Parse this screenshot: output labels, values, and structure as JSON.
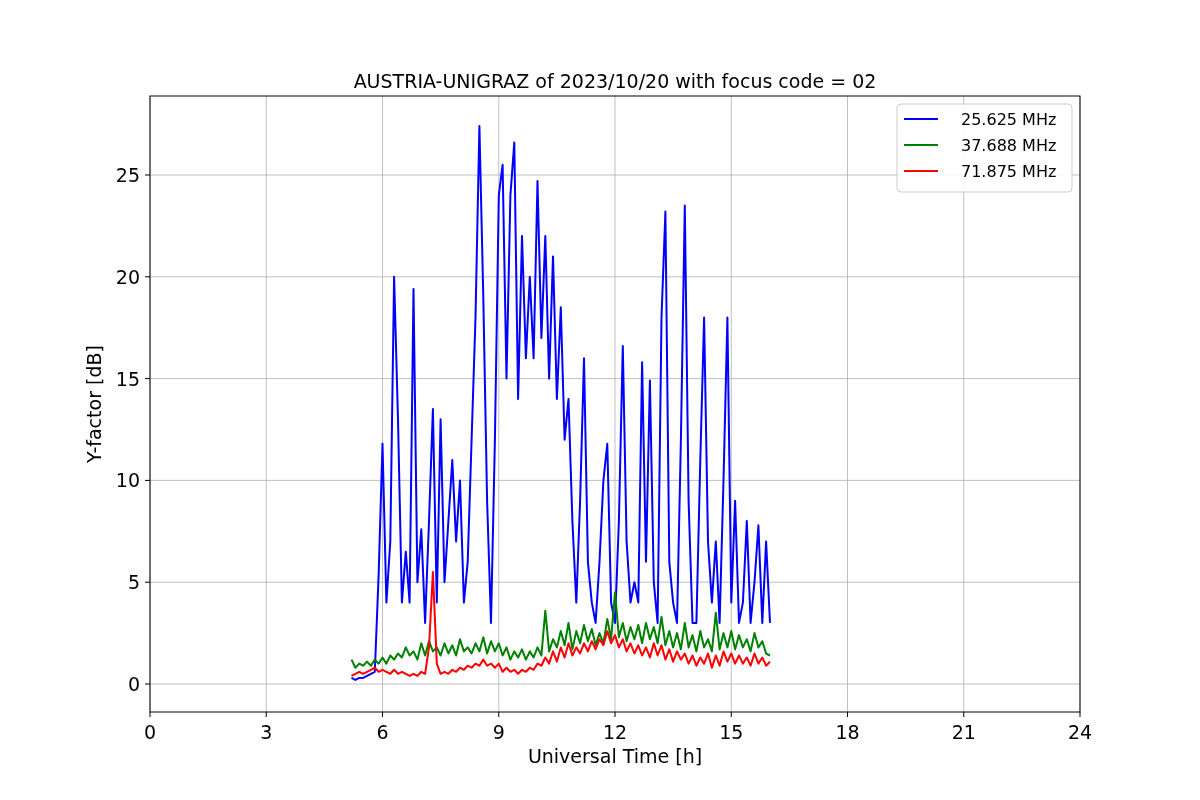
{
  "chart_data": {
    "type": "line",
    "grid": true,
    "legend": true,
    "title": "AUSTRIA-UNIGRAZ of 2023/10/20 with focus code = 02",
    "xlabel": "Universal Time [h]",
    "ylabel": "Y-factor [dB]",
    "xlim": [
      0,
      24
    ],
    "ylim": [
      -1.375,
      28.88
    ],
    "xticks": [
      0,
      3,
      6,
      9,
      12,
      15,
      18,
      21,
      24
    ],
    "yticks": [
      0,
      5,
      10,
      15,
      20,
      25
    ],
    "x": [
      5.2,
      5.3,
      5.4,
      5.5,
      5.6,
      5.7,
      5.8,
      5.9,
      6.0,
      6.1,
      6.2,
      6.3,
      6.4,
      6.5,
      6.6,
      6.7,
      6.8,
      6.9,
      7.0,
      7.1,
      7.2,
      7.3,
      7.4,
      7.5,
      7.6,
      7.7,
      7.8,
      7.9,
      8.0,
      8.1,
      8.2,
      8.3,
      8.4,
      8.5,
      8.6,
      8.7,
      8.8,
      8.9,
      9.0,
      9.1,
      9.2,
      9.3,
      9.4,
      9.5,
      9.6,
      9.7,
      9.8,
      9.9,
      10.0,
      10.1,
      10.2,
      10.3,
      10.4,
      10.5,
      10.6,
      10.7,
      10.8,
      10.9,
      11.0,
      11.1,
      11.2,
      11.3,
      11.4,
      11.5,
      11.6,
      11.7,
      11.8,
      11.9,
      12.0,
      12.1,
      12.2,
      12.3,
      12.4,
      12.5,
      12.6,
      12.7,
      12.8,
      12.9,
      13.0,
      13.1,
      13.2,
      13.3,
      13.4,
      13.5,
      13.6,
      13.7,
      13.8,
      13.9,
      14.0,
      14.1,
      14.2,
      14.3,
      14.4,
      14.5,
      14.6,
      14.7,
      14.8,
      14.9,
      15.0,
      15.1,
      15.2,
      15.3,
      15.4,
      15.5,
      15.6,
      15.7,
      15.8,
      15.9,
      16.0
    ],
    "series": [
      {
        "name": "25.625 MHz",
        "color": "#0000ff",
        "values": [
          0.3,
          0.2,
          0.3,
          0.3,
          0.4,
          0.5,
          0.6,
          5.3,
          11.8,
          4,
          7,
          20,
          13,
          4,
          6.5,
          4,
          19.4,
          5,
          7.6,
          3,
          8,
          13.5,
          4,
          13,
          5,
          8,
          11,
          7,
          10,
          4,
          6,
          12,
          18,
          27.4,
          19,
          9,
          3,
          12,
          24,
          25.5,
          15,
          24,
          26.6,
          14,
          22,
          16,
          20,
          16,
          24.7,
          17,
          22,
          15,
          21,
          14,
          18.5,
          12,
          14,
          8,
          4,
          9,
          16,
          6,
          4,
          3,
          6,
          10,
          11.8,
          4,
          3,
          8,
          16.6,
          7,
          4,
          5,
          4,
          15.8,
          6,
          14.9,
          5,
          3,
          18,
          23.2,
          6,
          4,
          3,
          12,
          23.5,
          9,
          3,
          3,
          11,
          18,
          7,
          4,
          7,
          3,
          10,
          18,
          4,
          9,
          3,
          4,
          8,
          3,
          5,
          7.8,
          3,
          7,
          3
        ]
      },
      {
        "name": "37.688 MHz",
        "color": "#008000",
        "values": [
          1.2,
          0.8,
          1.0,
          0.9,
          1.1,
          0.9,
          1.2,
          1.0,
          1.3,
          1.0,
          1.4,
          1.2,
          1.5,
          1.3,
          1.8,
          1.4,
          1.6,
          1.2,
          2.0,
          1.4,
          2.1,
          1.6,
          1.8,
          1.4,
          2.0,
          1.5,
          1.9,
          1.4,
          2.2,
          1.6,
          1.8,
          1.5,
          2.0,
          1.6,
          2.3,
          1.5,
          2.1,
          1.6,
          2.0,
          1.4,
          1.8,
          1.2,
          1.6,
          1.3,
          1.7,
          1.2,
          1.6,
          1.3,
          1.8,
          1.4,
          3.6,
          1.6,
          2.2,
          1.8,
          2.6,
          1.9,
          3.0,
          1.7,
          2.6,
          2.0,
          2.9,
          2.1,
          2.7,
          1.9,
          2.5,
          2.0,
          3.2,
          2.2,
          4.5,
          2.3,
          3.0,
          2.1,
          2.8,
          2.2,
          2.9,
          2.0,
          3.0,
          2.2,
          2.8,
          2.0,
          3.3,
          1.9,
          2.6,
          1.8,
          2.5,
          1.7,
          3.0,
          1.8,
          2.4,
          1.6,
          2.6,
          1.8,
          2.2,
          1.6,
          3.5,
          1.7,
          2.5,
          1.8,
          2.6,
          1.7,
          2.4,
          1.8,
          2.2,
          1.6,
          2.5,
          1.8,
          2.1,
          1.5,
          1.4
        ]
      },
      {
        "name": "71.875 MHz",
        "color": "#ff0000",
        "values": [
          0.4,
          0.5,
          0.6,
          0.5,
          0.6,
          0.7,
          0.8,
          0.6,
          0.7,
          0.6,
          0.5,
          0.7,
          0.5,
          0.6,
          0.5,
          0.4,
          0.5,
          0.4,
          0.6,
          0.5,
          1.8,
          5.5,
          1.0,
          0.5,
          0.6,
          0.5,
          0.7,
          0.6,
          0.8,
          0.7,
          0.9,
          0.8,
          1.0,
          0.9,
          1.2,
          0.9,
          1.0,
          0.8,
          1.0,
          0.6,
          0.8,
          0.6,
          0.7,
          0.5,
          0.7,
          0.6,
          0.8,
          0.7,
          1.0,
          0.9,
          1.3,
          1.0,
          1.6,
          1.1,
          1.8,
          1.3,
          2.0,
          1.4,
          1.8,
          1.5,
          2.0,
          1.6,
          2.1,
          1.7,
          2.2,
          1.9,
          2.6,
          2.0,
          2.4,
          1.8,
          2.2,
          1.6,
          2.0,
          1.5,
          1.9,
          1.4,
          1.8,
          1.3,
          2.0,
          1.4,
          1.9,
          1.2,
          1.7,
          1.1,
          1.6,
          1.2,
          1.5,
          1.0,
          1.4,
          0.9,
          1.3,
          1.0,
          1.5,
          0.8,
          1.4,
          0.9,
          1.6,
          1.1,
          1.5,
          1.0,
          1.4,
          1.0,
          1.3,
          0.9,
          1.5,
          1.0,
          1.3,
          0.9,
          1.1
        ]
      }
    ]
  }
}
